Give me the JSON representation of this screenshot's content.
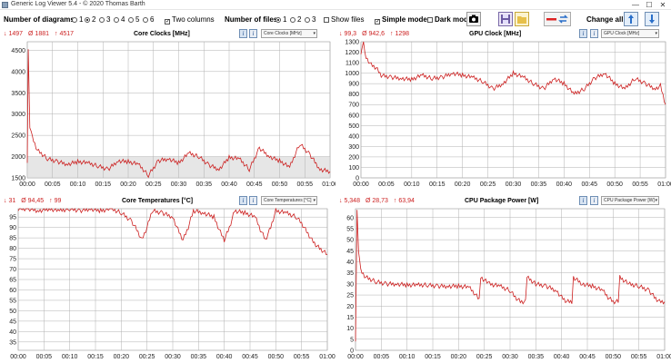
{
  "window": {
    "title": "Generic Log Viewer 5.4 - © 2020 Thomas Barth",
    "minimize": "—",
    "maximize": "☐",
    "close": "✕"
  },
  "toolbar": {
    "diagrams_label": "Number of diagrams",
    "diagram_options": [
      "1",
      "2",
      "3",
      "4",
      "5",
      "6"
    ],
    "diagram_selected": "2",
    "two_columns_label": "Two columns",
    "two_columns_checked": true,
    "files_label": "Number of files",
    "file_options": [
      "1",
      "2",
      "3"
    ],
    "file_selected": "1",
    "show_files_label": "Show files",
    "show_files_checked": false,
    "simple_mode_label": "Simple mode",
    "simple_mode_checked": true,
    "dark_mode_label": "Dark mod",
    "dark_mode_checked": false,
    "change_all_label": "Change all",
    "icons": [
      "camera-icon",
      "save-icon",
      "folder-icon",
      "swap-colors-icon",
      "shift-up-icon",
      "shift-down-icon"
    ]
  },
  "colors": {
    "series": "#cc1f1f",
    "grid": "#b0b0b0",
    "plot_bg": "#ffffff",
    "lower_band": "#e6e6e6"
  },
  "panels": [
    {
      "id": "core-clocks",
      "title": "Core Clocks [MHz]",
      "combo": "Core Clocks [MHz]",
      "stat_min": "↓ 1497",
      "stat_avg": "Ø 1881",
      "stat_max": "↑ 4517",
      "chart_data": {
        "type": "line",
        "title": "Core Clocks [MHz]",
        "x_ticks": [
          "00:00",
          "00:05",
          "00:10",
          "00:15",
          "00:20",
          "00:25",
          "00:30",
          "00:35",
          "00:40",
          "00:45",
          "00:50",
          "00:55",
          "01:00"
        ],
        "ylim": [
          1500,
          4700
        ],
        "y_ticks": [
          1500,
          2000,
          2500,
          3000,
          3500,
          4000,
          4500
        ],
        "series": [
          {
            "values_minutes": [
              0,
              0.2,
              0.5,
              1,
              2,
              4,
              6,
              8,
              10,
              12,
              14,
              16,
              18,
              20,
              22,
              24,
              26,
              28,
              30,
              32,
              34,
              36,
              38,
              40,
              42,
              44,
              46,
              48,
              50,
              52,
              54,
              56,
              58,
              60
            ],
            "values": [
              1900,
              4500,
              2700,
              2450,
              2150,
              1950,
              1880,
              1820,
              1880,
              1850,
              1780,
              1700,
              1900,
              1880,
              1820,
              1560,
              1900,
              1950,
              1850,
              2080,
              2000,
              1800,
              1700,
              1980,
              1950,
              1700,
              2200,
              2000,
              1900,
              1750,
              2300,
              2050,
              1700,
              1650
            ]
          }
        ]
      }
    },
    {
      "id": "gpu-clock",
      "title": "GPU Clock [MHz]",
      "combo": "GPU Clock [MHz]",
      "stat_min": "↓ 99,3",
      "stat_avg": "Ø 942,6",
      "stat_max": "↑ 1298",
      "chart_data": {
        "type": "line",
        "title": "GPU Clock [MHz]",
        "x_ticks": [
          "00:00",
          "00:05",
          "00:10",
          "00:15",
          "00:20",
          "00:25",
          "00:30",
          "00:35",
          "00:40",
          "00:45",
          "00:50",
          "00:55",
          "01:00"
        ],
        "ylim": [
          0,
          1300
        ],
        "y_ticks": [
          0,
          100,
          200,
          300,
          400,
          500,
          600,
          700,
          800,
          900,
          1000,
          1100,
          1200,
          1300
        ],
        "series": [
          {
            "values_minutes": [
              0,
              0.5,
              1,
              2,
              3,
              4,
              6,
              8,
              10,
              12,
              14,
              16,
              18,
              20,
              22,
              24,
              26,
              28,
              30,
              32,
              34,
              36,
              38,
              40,
              42,
              44,
              46,
              48,
              50,
              52,
              54,
              56,
              58,
              59,
              60
            ],
            "values": [
              1200,
              1298,
              1150,
              1080,
              1050,
              980,
              960,
              950,
              940,
              980,
              950,
              960,
              1000,
              980,
              960,
              920,
              850,
              900,
              1000,
              960,
              900,
              850,
              950,
              900,
              800,
              850,
              950,
              1000,
              900,
              850,
              950,
              900,
              850,
              880,
              700
            ]
          }
        ]
      }
    },
    {
      "id": "core-temps",
      "title": "Core Temperatures [°C]",
      "combo": "Core Temperatures [°C]",
      "stat_min": "↓ 31",
      "stat_avg": "Ø 94,45",
      "stat_max": "↑ 99",
      "chart_data": {
        "type": "line",
        "title": "Core Temperatures [°C]",
        "x_ticks": [
          "00:00",
          "00:05",
          "00:10",
          "00:15",
          "00:20",
          "00:25",
          "00:30",
          "00:35",
          "00:40",
          "00:45",
          "00:50",
          "00:55",
          "01:00"
        ],
        "ylim": [
          31,
          99
        ],
        "y_ticks": [
          35,
          40,
          45,
          50,
          55,
          60,
          65,
          70,
          75,
          80,
          85,
          90,
          95
        ],
        "series": [
          {
            "values_minutes": [
              0,
              2,
              4,
              6,
              8,
              10,
              12,
              14,
              16,
              18,
              20,
              22,
              23,
              24,
              25,
              26,
              28,
              30,
              31,
              32,
              33,
              34,
              36,
              38,
              39,
              40,
              41,
              42,
              44,
              46,
              47,
              48,
              49,
              50,
              52,
              54,
              55,
              56,
              57,
              58,
              59,
              60
            ],
            "values": [
              99,
              99,
              98,
              99,
              98,
              99,
              98,
              99,
              98,
              99,
              97,
              93,
              89,
              84,
              90,
              98,
              97,
              95,
              89,
              84,
              90,
              98,
              97,
              95,
              89,
              84,
              90,
              98,
              97,
              95,
              89,
              84,
              90,
              98,
              97,
              95,
              92,
              88,
              84,
              81,
              79,
              77
            ]
          }
        ]
      }
    },
    {
      "id": "cpu-package-power",
      "title": "CPU Package Power [W]",
      "combo": "CPU Package Power [W]",
      "stat_min": "↓ 5,348",
      "stat_avg": "Ø 28,73",
      "stat_max": "↑ 63,94",
      "chart_data": {
        "type": "line",
        "title": "CPU Package Power [W]",
        "x_ticks": [
          "00:00",
          "00:05",
          "00:10",
          "00:15",
          "00:20",
          "00:25",
          "00:30",
          "00:35",
          "00:40",
          "00:45",
          "00:50",
          "00:55",
          "01:00"
        ],
        "ylim": [
          0,
          64
        ],
        "y_ticks": [
          0,
          5,
          10,
          15,
          20,
          25,
          30,
          35,
          40,
          45,
          50,
          55,
          60
        ],
        "series": [
          {
            "values_minutes": [
              0,
              0.3,
              0.6,
              1,
              2,
              4,
              6,
              8,
              10,
              12,
              14,
              16,
              18,
              20,
              22,
              23,
              24,
              24.3,
              26,
              28,
              30,
              31,
              32,
              33,
              33.3,
              35,
              37,
              39,
              40,
              41,
              42,
              42.3,
              44,
              46,
              48,
              49,
              50,
              51,
              51.3,
              53,
              55,
              57,
              58,
              59,
              60
            ],
            "values": [
              5,
              63,
              45,
              36,
              33,
              31,
              30,
              30,
              29.5,
              29.5,
              29.5,
              29,
              29,
              29,
              28.5,
              26,
              23,
              33,
              30,
              29,
              27,
              24,
              22,
              22,
              33,
              30,
              29,
              27,
              24,
              22,
              22,
              33,
              30,
              29,
              27,
              24,
              22,
              22,
              33,
              30,
              29,
              27,
              24,
              22,
              22
            ]
          }
        ]
      }
    }
  ]
}
